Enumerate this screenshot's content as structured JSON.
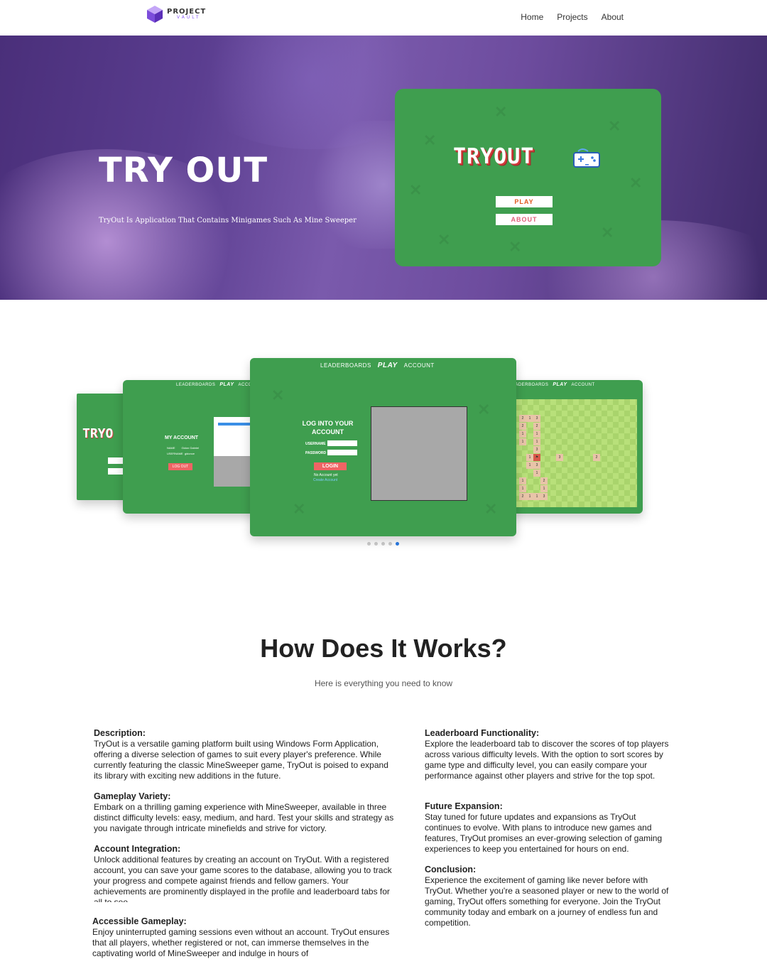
{
  "nav": {
    "logo_line1": "PROJECT",
    "logo_line2": "VAULT",
    "links": [
      "Home",
      "Projects",
      "About"
    ]
  },
  "hero": {
    "title": "TRY OUT",
    "subtitle": "TryOut Is Application That Contains Minigames Such As Mine Sweeper",
    "card": {
      "logo": "TRYOUT",
      "play_label": "PLAY",
      "about_label": "ABOUT"
    }
  },
  "carousel": {
    "slide_nav": {
      "leaderboards": "LEADERBOARDS",
      "play": "PLAY",
      "account": "ACCOUNT"
    },
    "center": {
      "login_title": "LOG INTO YOUR ACCOUNT",
      "username_label": "USERNAME",
      "password_label": "PASSWORD",
      "login_button": "LOGIN",
      "no_account": "No Account yet",
      "create_account": "Create Account"
    },
    "left": {
      "title": "MY ACCOUNT",
      "name_label": "NAME",
      "name_value": "Gidon Gabriel",
      "username_label": "USERNAME",
      "username_value": "gidonce",
      "logout_button": "LOG OUT"
    },
    "far_logo": "TRYO",
    "dots_count": 5,
    "active_dot": 4
  },
  "how": {
    "title": "How Does It Works?",
    "subtitle": "Here is everything you need to know",
    "left_sections": [
      {
        "heading": "Description:",
        "body": "TryOut is a versatile gaming platform built using Windows Form Application, offering a diverse selection of games to suit every player's preference. While currently featuring the classic MineSweeper game, TryOut is poised to expand its library with exciting new additions in the future."
      },
      {
        "heading": "Gameplay Variety:",
        "body": "Embark on a thrilling gaming experience with MineSweeper, available in three distinct difficulty levels: easy, medium, and hard. Test your skills and strategy as you navigate through intricate minefields and strive for victory."
      },
      {
        "heading": "Account Integration:",
        "body": "Unlock additional features by creating an account on TryOut. With a registered account, you can save your game scores to the database, allowing you to track your progress and compete against friends and fellow gamers. Your achievements are prominently displayed in the profile and leaderboard tabs for all to see."
      },
      {
        "heading": "Accessible Gameplay:",
        "body": "Enjoy uninterrupted gaming sessions even without an account. TryOut ensures that all players, whether registered or not, can immerse themselves in the captivating world of MineSweeper and indulge in hours of"
      }
    ],
    "right_sections": [
      {
        "heading": "Leaderboard Functionality:",
        "body": "Explore the leaderboard tab to discover the scores of top players across various difficulty levels. With the option to sort scores by game type and difficulty level, you can easily compare your performance against other players and strive for the top spot."
      },
      {
        "heading": "Future Expansion:",
        "body": "Stay tuned for future updates and expansions as TryOut continues to evolve. With plans to introduce new games and features, TryOut promises an ever-growing selection of gaming experiences to keep you entertained for hours on end."
      },
      {
        "heading": "Conclusion:",
        "body": "Experience the excitement of gaming like never before with TryOut. Whether you're a seasoned player or new to the world of gaming, TryOut offers something for everyone. Join the TryOut community today and embark on a journey of endless fun and competition."
      }
    ]
  },
  "colors": {
    "hero_purple": "#5a3d8f",
    "card_green": "#3f9e4f",
    "button_red": "#f06464",
    "active_dot": "#2a7be4"
  }
}
